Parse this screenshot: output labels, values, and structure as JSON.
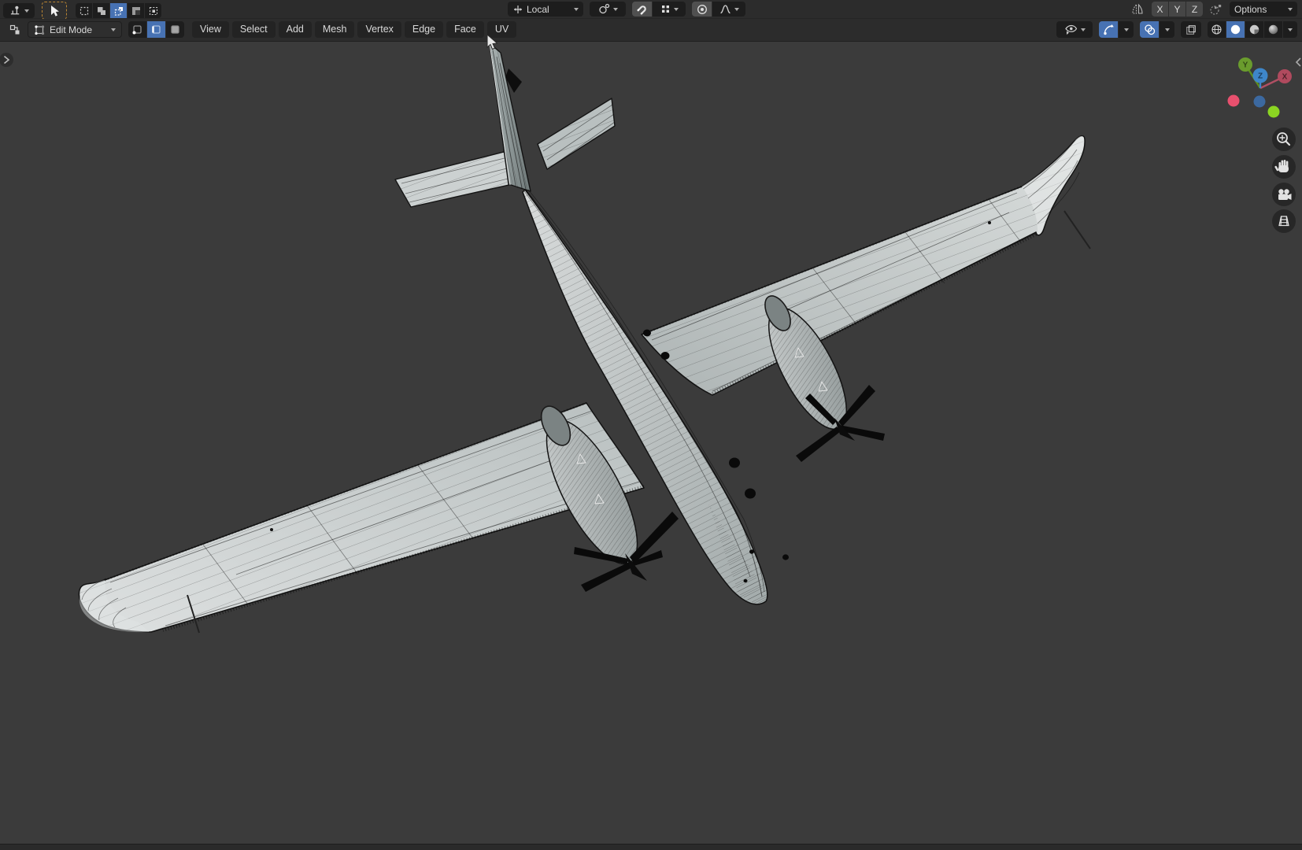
{
  "tool_settings": {
    "orientation_label": "Local",
    "mirror_axes": [
      "X",
      "Y",
      "Z"
    ],
    "options_label": "Options"
  },
  "viewport_header": {
    "mode": "Edit Mode",
    "menus": [
      "View",
      "Select",
      "Add",
      "Mesh",
      "Vertex",
      "Edge",
      "Face",
      "UV"
    ]
  },
  "nav_gizmo": {
    "x_label": "X",
    "y_label": "Y",
    "z_label": "Z"
  },
  "colors": {
    "accent_blue": "#4772b3",
    "header_bg": "#2c2c2c",
    "viewport_bg": "#3b3b3b",
    "active_tool_outline": "#b88433",
    "axis_x_pos": "#b04a5e",
    "axis_x_neg": "#e8506e",
    "axis_y_pos": "#6a9c2d",
    "axis_y_neg": "#8bd522",
    "axis_z_pos": "#3e86c9",
    "axis_z_neg": "#3c69a0"
  }
}
